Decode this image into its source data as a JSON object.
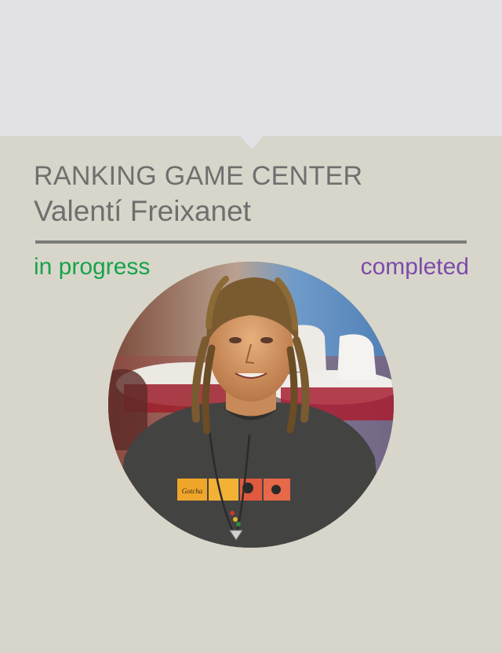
{
  "header": {
    "title": "RANKING GAME CENTER",
    "player_name": "Valentí Freixanet"
  },
  "tabs": {
    "in_progress_label": "in progress",
    "completed_label": "completed"
  },
  "colors": {
    "background": "#d8d6ca",
    "top_band": "#e2e2e4",
    "heading_text": "#6f6f6f",
    "in_progress": "#16a34a",
    "completed": "#7c4bab"
  },
  "avatar": {
    "shirt_print_text": "Gotcha"
  }
}
